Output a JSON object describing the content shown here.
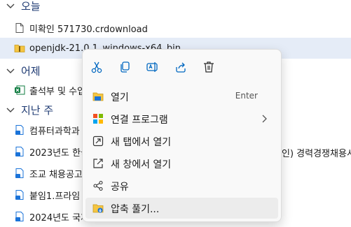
{
  "groups": [
    {
      "label": "오늘"
    },
    {
      "label": "어제"
    },
    {
      "label": "지난 주"
    }
  ],
  "files": [
    {
      "name": "미확인 571730.crdownload",
      "icon": "blank-file-icon"
    },
    {
      "name": "openjdk-21.0.1_windows-x64_bin",
      "icon": "zip-folder-icon"
    },
    {
      "name": "출석부 및 수업",
      "icon": "excel-file-icon"
    },
    {
      "name": "컴퓨터과학과",
      "icon": "document-file-icon"
    },
    {
      "name": "2023년도 한국",
      "icon": "document-file-icon"
    },
    {
      "name": "조교 채용공고",
      "icon": "document-file-icon"
    },
    {
      "name": "붙임1.프라임",
      "icon": "document-file-icon"
    },
    {
      "name": "2024년도 국제",
      "icon": "document-file-icon"
    }
  ],
  "overflow_text": "인) 경력경쟁채용시",
  "context_menu": {
    "toolbar": [
      {
        "name": "cut-icon"
      },
      {
        "name": "copy-icon"
      },
      {
        "name": "rename-icon"
      },
      {
        "name": "share-icon"
      },
      {
        "name": "delete-icon"
      }
    ],
    "items": [
      {
        "label": "열기",
        "shortcut": "Enter",
        "icon": "folder-open-icon"
      },
      {
        "label": "연결 프로그램",
        "icon": "open-with-icon"
      },
      {
        "label": "새 탭에서 열기",
        "icon": "new-tab-icon"
      },
      {
        "label": "새 창에서 열기",
        "icon": "new-window-icon"
      },
      {
        "label": "공유",
        "icon": "share-icon"
      },
      {
        "label": "압축 풀기...",
        "icon": "extract-icon"
      }
    ]
  },
  "colors": {
    "accent": "#0067c0",
    "folder": "#f5c542",
    "selected_row": "#e5ecf7",
    "menu_bg": "#f9f9f9"
  }
}
